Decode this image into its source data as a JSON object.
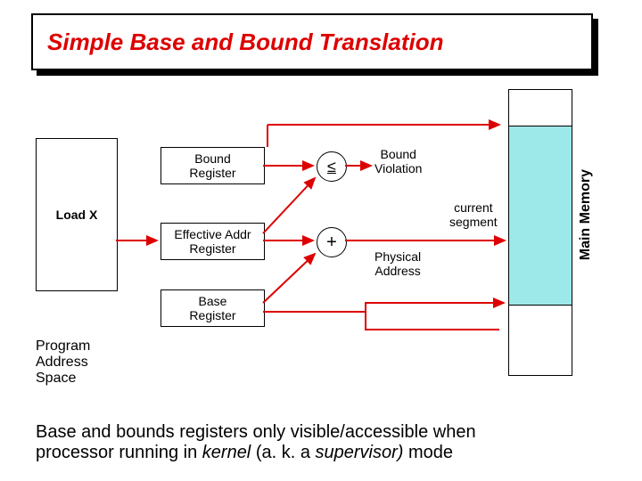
{
  "title": "Simple Base and Bound Translation",
  "loadx": "Load X",
  "bound": "Bound\nRegister",
  "ea": "Effective Addr\nRegister",
  "base": "Base\nRegister",
  "le": "≤",
  "plus": "+",
  "violation": "Bound\nViolation",
  "phys": "Physical\nAddress",
  "curseg": "current\nsegment",
  "mm": "Main Memory",
  "pas1": "Program",
  "pas2": "Address",
  "pas3": "Space",
  "cap1": "Base and bounds registers only visible/accessible when",
  "cap2": "processor running in ",
  "k": "kernel",
  "mid": " (a. k. a ",
  "s": "supervisor)",
  "end": " mode"
}
